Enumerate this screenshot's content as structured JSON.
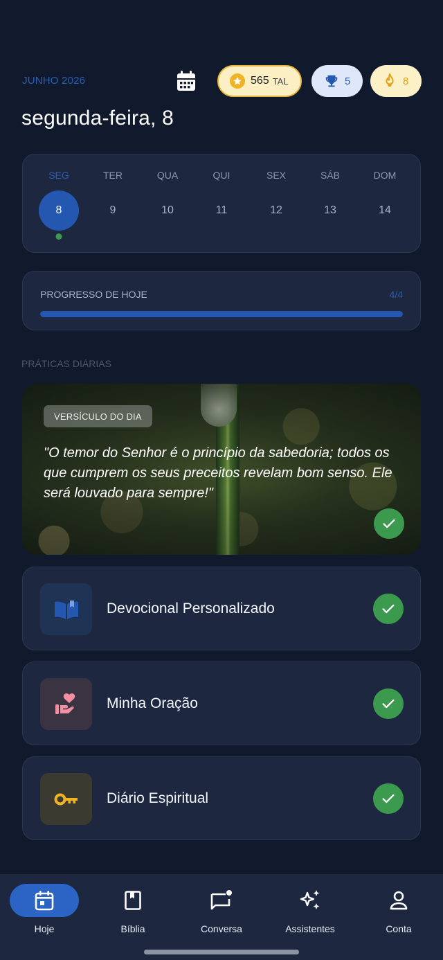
{
  "header": {
    "month": "JUNHO 2026",
    "date_title": "segunda-feira, 8",
    "tal": {
      "value": "565",
      "unit": "TAL"
    },
    "trophies": "5",
    "streak": "8"
  },
  "week": {
    "days": [
      {
        "name": "SEG",
        "num": "8",
        "active": true,
        "done": true
      },
      {
        "name": "TER",
        "num": "9"
      },
      {
        "name": "QUA",
        "num": "10"
      },
      {
        "name": "QUI",
        "num": "11"
      },
      {
        "name": "SEX",
        "num": "12"
      },
      {
        "name": "SÁB",
        "num": "13"
      },
      {
        "name": "DOM",
        "num": "14"
      }
    ]
  },
  "progress": {
    "label": "PROGRESSO DE HOJE",
    "value": "4/4",
    "fraction": 1.0
  },
  "section_label": "PRÁTICAS DIÁRIAS",
  "verse": {
    "tag": "VERSÍCULO DO DIA",
    "text": "\"O temor do Senhor é o princípio da sabedoria; todos os que cumprem os seus preceitos revelam bom senso. Ele será louvado para sempre!\""
  },
  "practices": [
    {
      "title": "Devocional Personalizado",
      "icon": "open-book-icon",
      "done": true
    },
    {
      "title": "Minha Oração",
      "icon": "heart-hand-icon",
      "done": true
    },
    {
      "title": "Diário Espiritual",
      "icon": "key-icon",
      "done": true
    }
  ],
  "nav": [
    {
      "label": "Hoje",
      "icon": "calendar-icon",
      "active": true
    },
    {
      "label": "Bíblia",
      "icon": "bible-icon"
    },
    {
      "label": "Conversa",
      "icon": "chat-icon"
    },
    {
      "label": "Assistentes",
      "icon": "sparkles-icon"
    },
    {
      "label": "Conta",
      "icon": "person-icon"
    }
  ],
  "colors": {
    "background": "#111a2c",
    "card": "#1d2840",
    "accent": "#2458b0",
    "success": "#3c9a4e",
    "gold": "#f0b324"
  }
}
